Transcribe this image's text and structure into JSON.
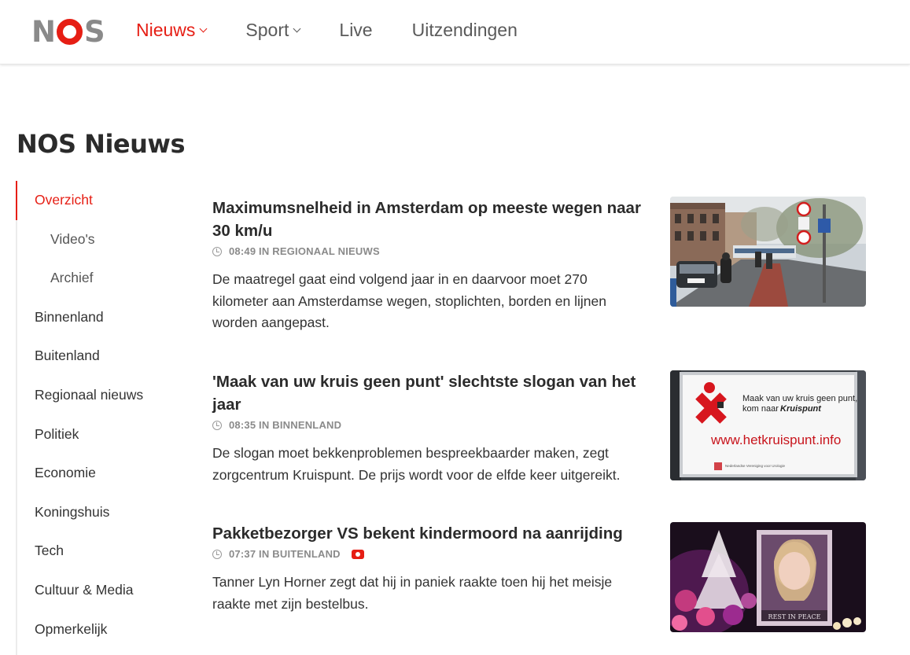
{
  "header": {
    "logo": "NOS",
    "nav": [
      {
        "label": "Nieuws",
        "dropdown": true,
        "active": true
      },
      {
        "label": "Sport",
        "dropdown": true,
        "active": false
      },
      {
        "label": "Live",
        "dropdown": false,
        "active": false
      },
      {
        "label": "Uitzendingen",
        "dropdown": false,
        "active": false
      }
    ]
  },
  "page": {
    "title": "NOS Nieuws"
  },
  "sidebar": {
    "items": [
      {
        "label": "Overzicht"
      },
      {
        "label": "Video's"
      },
      {
        "label": "Archief"
      },
      {
        "label": "Binnenland"
      },
      {
        "label": "Buitenland"
      },
      {
        "label": "Regionaal nieuws"
      },
      {
        "label": "Politiek"
      },
      {
        "label": "Economie"
      },
      {
        "label": "Koningshuis"
      },
      {
        "label": "Tech"
      },
      {
        "label": "Cultuur & Media"
      },
      {
        "label": "Opmerkelijk"
      }
    ]
  },
  "articles": [
    {
      "title": "Maximumsnelheid in Amsterdam op meeste wegen naar 30 km/u",
      "meta": "08:49 IN REGIONAAL NIEUWS",
      "description": "De maatregel gaat eind volgend jaar in en daarvoor moet 270 kilometer aan Amsterdamse wegen, stoplichten, borden en lijnen worden aangepast."
    },
    {
      "title": "'Maak van uw kruis geen punt' slechtste slogan van het jaar",
      "meta": "08:35 IN BINNENLAND",
      "description": "De slogan moet bekkenproblemen bespreekbaarder maken, zegt zorgcentrum Kruispunt. De prijs wordt voor de elfde keer uitgereikt.",
      "image_text": {
        "line1": "Maak van uw kruis geen punt,",
        "line2": "kom naar",
        "brand": "Kruispunt",
        "url": "www.hetkruispunt.info",
        "small": "Nederlandse Vereniging voor Urologie"
      }
    },
    {
      "title": "Pakketbezorger VS bekent kindermoord na aanrijding",
      "meta": "07:37 IN BUITENLAND",
      "description": "Tanner Lyn Horner zegt dat hij in paniek raakte toen hij het meisje raakte met zijn bestelbus.",
      "image_text": {
        "caption": "REST IN PEACE"
      }
    }
  ],
  "colors": {
    "accent": "#e61e14",
    "logo_gray": "#8a8a8a",
    "text": "#2b2b2b"
  }
}
